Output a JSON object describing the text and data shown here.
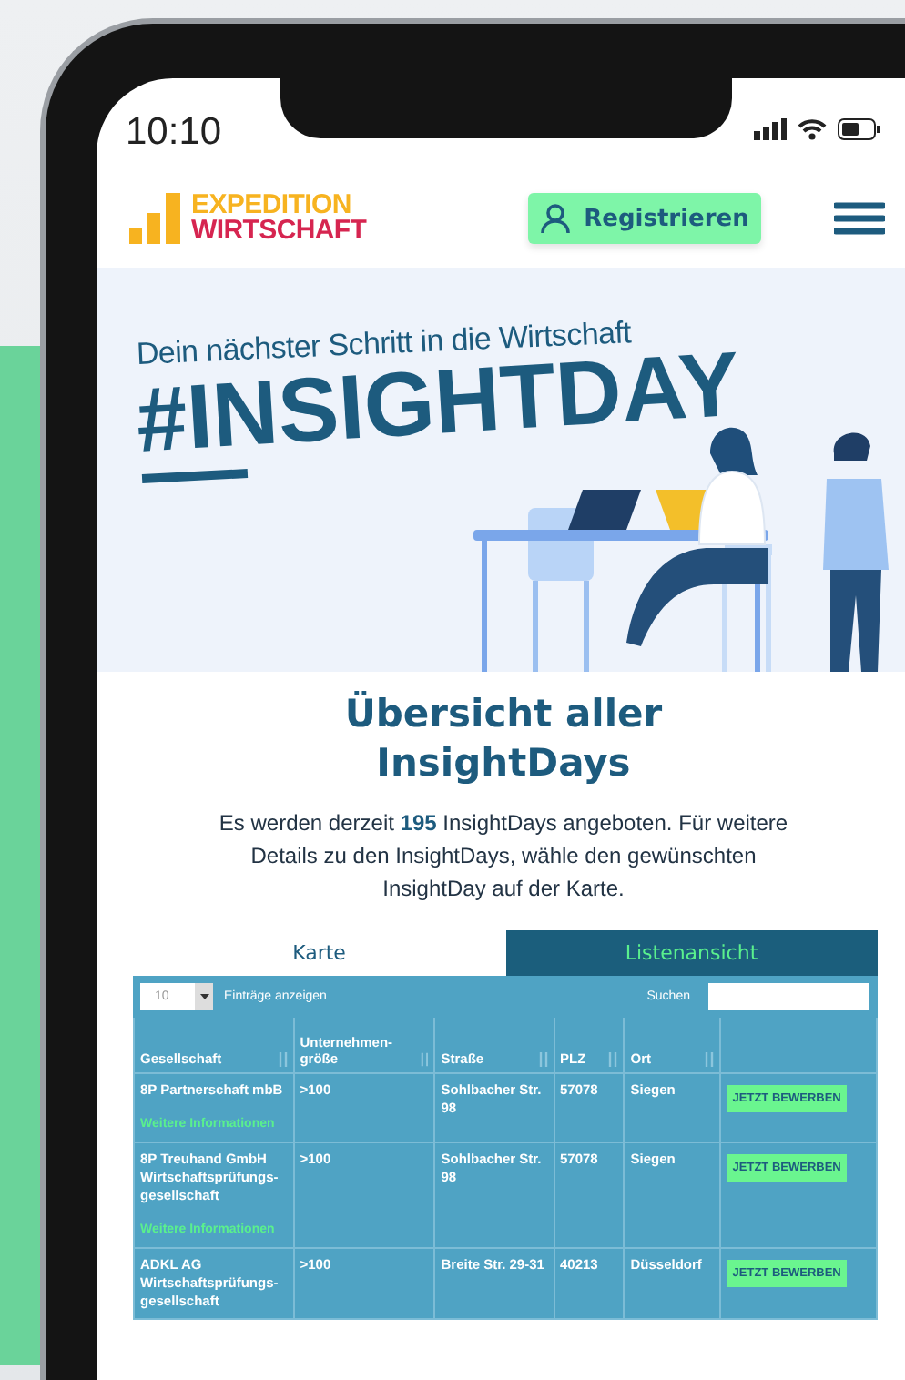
{
  "status_bar": {
    "time": "10:10"
  },
  "header": {
    "logo": {
      "line_1": "EXPEDITION",
      "line_2": "WIRTSCHAFT"
    },
    "register_button": "Registrieren"
  },
  "hero": {
    "tagline": "Dein nächster Schritt in die Wirtschaft",
    "headline": "#INSIGHTDAY"
  },
  "title": "Übersicht aller InsightDays",
  "intro": "Es werden derzeit **195** InsightDays angeboten. Für weitere Details zu den InsightDays, wähle den gewünschten InsightDay auf der Karte.",
  "view_tabs": [
    {
      "label": "Karte",
      "selected": false
    },
    {
      "label": "Listenansicht",
      "selected": true
    }
  ],
  "table_controls": {
    "page_size": "10",
    "page_size_label": "Einträge anzeigen",
    "search_label": "Suchen"
  },
  "table": {
    "columns": [
      "Gesellschaft",
      "Unternehmen-größe",
      "Straße",
      "PLZ",
      "Ort"
    ],
    "rows": [
      {
        "company": "8P Partnerschaft mbB",
        "more_link": "Weitere Informationen",
        "size": ">100",
        "street": "Sohlbacher Str. 98",
        "zip": "57078",
        "city": "Siegen",
        "apply_button": "JETZT BEWERBEN"
      },
      {
        "company": "8P Treuhand GmbH Wirtschaftsprüfungs-gesellschaft",
        "more_link": "Weitere Informationen",
        "size": ">100",
        "street": "Sohlbacher Str. 98",
        "zip": "57078",
        "city": "Siegen",
        "apply_button": "JETZT BEWERBEN"
      },
      {
        "company": "ADKL AG Wirtschaftsprüfungs-gesellschaft",
        "size": ">100",
        "street": "Breite Str. 29-31",
        "zip": "40213",
        "city": "Düsseldorf",
        "apply_button": "JETZT BEWERBEN"
      }
    ]
  }
}
